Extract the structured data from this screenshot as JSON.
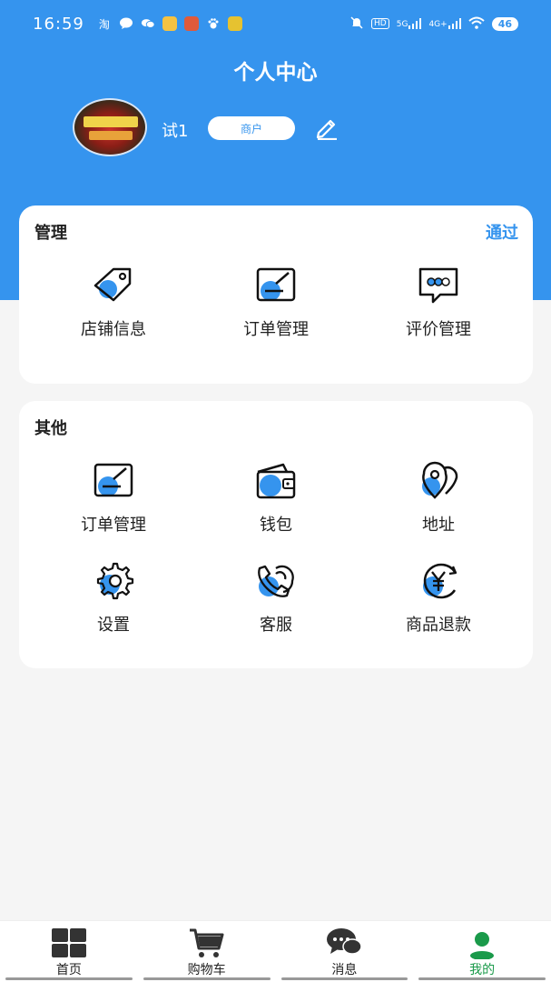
{
  "status_bar": {
    "time": "16:59",
    "network_hd": "HD",
    "network_5g": "5G",
    "network_4g": "4G+",
    "battery": "46"
  },
  "header": {
    "title": "个人中心",
    "username": "试1",
    "role": "商户"
  },
  "manage": {
    "title": "管理",
    "status": "通过",
    "items": [
      {
        "label": "店铺信息",
        "icon": "tag-icon"
      },
      {
        "label": "订单管理",
        "icon": "order-icon"
      },
      {
        "label": "评价管理",
        "icon": "comment-icon"
      }
    ]
  },
  "other": {
    "title": "其他",
    "items": [
      {
        "label": "订单管理",
        "icon": "order-icon"
      },
      {
        "label": "钱包",
        "icon": "wallet-icon"
      },
      {
        "label": "地址",
        "icon": "location-icon"
      },
      {
        "label": "设置",
        "icon": "gear-icon"
      },
      {
        "label": "客服",
        "icon": "phone-icon"
      },
      {
        "label": "商品退款",
        "icon": "refund-icon"
      }
    ]
  },
  "tabbar": {
    "items": [
      {
        "label": "首页",
        "icon": "home-grid-icon"
      },
      {
        "label": "购物车",
        "icon": "cart-icon"
      },
      {
        "label": "消息",
        "icon": "chat-icon"
      },
      {
        "label": "我的",
        "icon": "me-icon",
        "active": true
      }
    ]
  },
  "colors": {
    "primary": "#3594ee",
    "active_tab": "#1a9a4a"
  }
}
